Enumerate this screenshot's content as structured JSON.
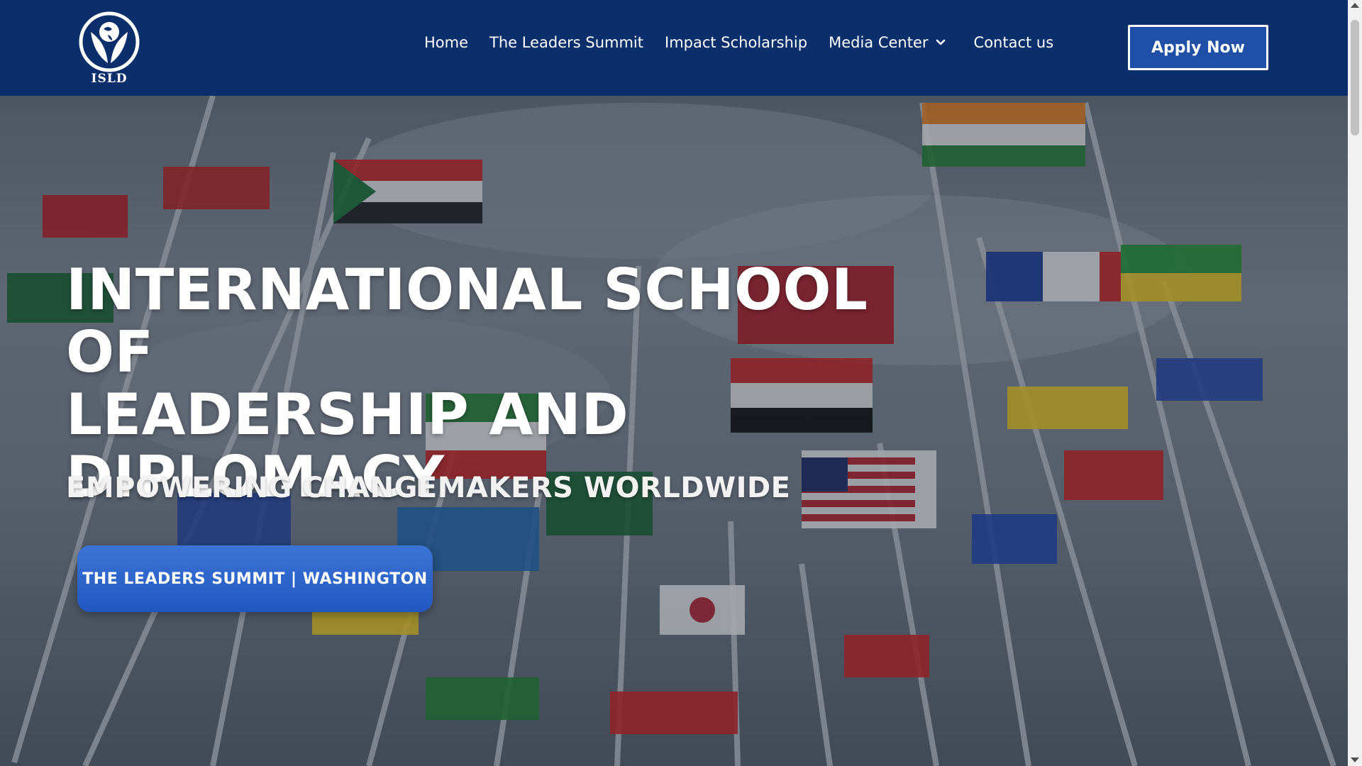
{
  "header": {
    "logo_text": "ISLD",
    "nav": [
      {
        "label": "Home"
      },
      {
        "label": "The Leaders Summit"
      },
      {
        "label": "Impact Scholarship"
      },
      {
        "label": "Media Center",
        "has_dropdown": true
      },
      {
        "label": "Contact us"
      }
    ],
    "apply_label": "Apply Now"
  },
  "hero": {
    "title_lines": [
      "INTERNATIONAL SCHOOL OF",
      "LEADERSHIP AND",
      "DIPLOMACY"
    ],
    "subtitle": "EMPOWERING CHANGEMAKERS WORLDWIDE",
    "cta_label": "THE LEADERS SUMMIT | WASHINGTON",
    "background": "international flags on flagpoles against cloudy sky"
  },
  "colors": {
    "header_bg": "#0b2f6b",
    "button_blue": "#2257c0",
    "text": "#ffffff"
  },
  "icons": [
    "globe-hands-logo-icon",
    "chevron-down-icon",
    "scroll-up-icon",
    "scroll-down-icon"
  ]
}
